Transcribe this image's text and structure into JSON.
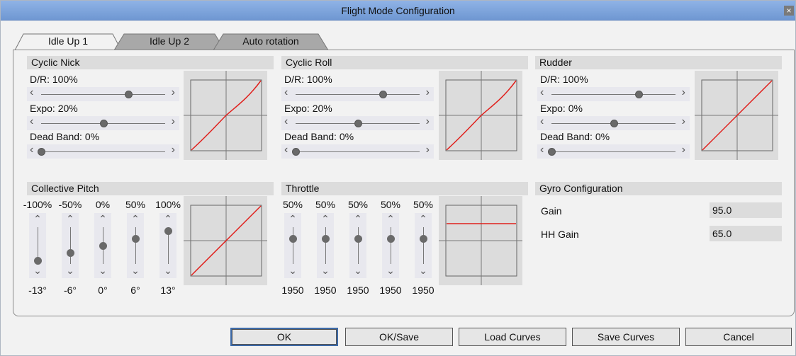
{
  "window": {
    "title": "Flight Mode Configuration",
    "close_icon": "close-icon"
  },
  "tabs": [
    {
      "label": "Idle Up 1",
      "active": true
    },
    {
      "label": "Idle Up 2",
      "active": false
    },
    {
      "label": "Auto rotation",
      "active": false
    }
  ],
  "curve_color": "#e0201c",
  "sections": {
    "cyclic_nick": {
      "title": "Cyclic Nick",
      "dr_label": "D/R: 100%",
      "dr_value": 0.7,
      "expo_label": "Expo: 20%",
      "expo_value": 0.5,
      "deadband_label": "Dead Band: 0%",
      "deadband_value": 0.0
    },
    "cyclic_roll": {
      "title": "Cyclic Roll",
      "dr_label": "D/R: 100%",
      "dr_value": 0.7,
      "expo_label": "Expo: 20%",
      "expo_value": 0.5,
      "deadband_label": "Dead Band: 0%",
      "deadband_value": 0.0
    },
    "rudder": {
      "title": "Rudder",
      "dr_label": "D/R: 100%",
      "dr_value": 0.7,
      "expo_label": "Expo: 0%",
      "expo_value": 0.5,
      "deadband_label": "Dead Band: 0%",
      "deadband_value": 0.0
    },
    "collective_pitch": {
      "title": "Collective Pitch",
      "points": [
        {
          "top": "-100%",
          "bottom": "-13°",
          "level": 0.1
        },
        {
          "top": "-50%",
          "bottom": "-6°",
          "level": 0.3
        },
        {
          "top": "0%",
          "bottom": "0°",
          "level": 0.5
        },
        {
          "top": "50%",
          "bottom": "6°",
          "level": 0.7
        },
        {
          "top": "100%",
          "bottom": "13°",
          "level": 0.9
        }
      ]
    },
    "throttle": {
      "title": "Throttle",
      "points": [
        {
          "top": "50%",
          "bottom": "1950",
          "level": 0.7
        },
        {
          "top": "50%",
          "bottom": "1950",
          "level": 0.7
        },
        {
          "top": "50%",
          "bottom": "1950",
          "level": 0.7
        },
        {
          "top": "50%",
          "bottom": "1950",
          "level": 0.7
        },
        {
          "top": "50%",
          "bottom": "1950",
          "level": 0.7
        }
      ]
    },
    "gyro": {
      "title": "Gyro Configuration",
      "gain_label": "Gain",
      "gain_value": "95.0",
      "hh_gain_label": "HH Gain",
      "hh_gain_value": "65.0"
    }
  },
  "buttons": {
    "ok": "OK",
    "ok_save": "OK/Save",
    "load_curves": "Load Curves",
    "save_curves": "Save Curves",
    "cancel": "Cancel"
  }
}
